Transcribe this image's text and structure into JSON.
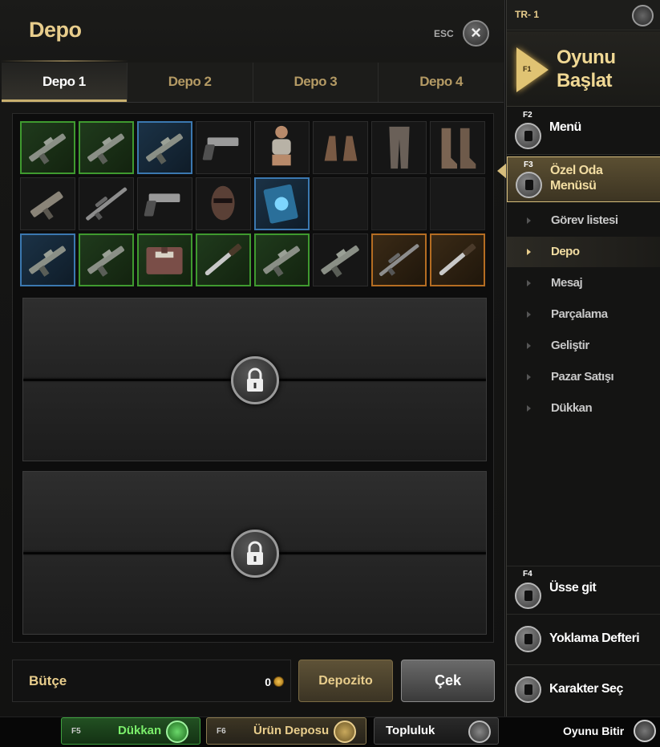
{
  "window": {
    "title": "Depo",
    "esc_label": "ESC"
  },
  "tabs": [
    {
      "label": "Depo 1",
      "active": true
    },
    {
      "label": "Depo 2",
      "active": false
    },
    {
      "label": "Depo 3",
      "active": false
    },
    {
      "label": "Depo 4",
      "active": false
    }
  ],
  "inventory": {
    "slots": [
      {
        "item": "rifle-icon",
        "rarity": "green"
      },
      {
        "item": "rifle-icon",
        "rarity": "green"
      },
      {
        "item": "rifle-icon",
        "rarity": "blue"
      },
      {
        "item": "pistol-icon",
        "rarity": "none"
      },
      {
        "item": "top-clothing-icon",
        "rarity": "none"
      },
      {
        "item": "gloves-icon",
        "rarity": "none"
      },
      {
        "item": "pants-icon",
        "rarity": "none"
      },
      {
        "item": "boots-icon",
        "rarity": "none"
      },
      {
        "item": "smg-icon",
        "rarity": "none"
      },
      {
        "item": "sniper-rifle-icon",
        "rarity": "none"
      },
      {
        "item": "pistol-icon",
        "rarity": "none"
      },
      {
        "item": "mask-icon",
        "rarity": "none"
      },
      {
        "item": "card-icon",
        "rarity": "blue"
      },
      {
        "item": "",
        "rarity": "empty"
      },
      {
        "item": "",
        "rarity": "empty"
      },
      {
        "item": "",
        "rarity": "empty"
      },
      {
        "item": "rifle-icon",
        "rarity": "blue"
      },
      {
        "item": "rifle-icon",
        "rarity": "green"
      },
      {
        "item": "medkit-icon",
        "rarity": "green"
      },
      {
        "item": "knife-icon",
        "rarity": "green"
      },
      {
        "item": "rifle-icon",
        "rarity": "green"
      },
      {
        "item": "rifle-icon",
        "rarity": "none"
      },
      {
        "item": "sniper-rifle-icon",
        "rarity": "orange"
      },
      {
        "item": "knife-icon",
        "rarity": "orange"
      }
    ],
    "locked_sections": [
      {
        "icon": "lock-icon"
      },
      {
        "icon": "lock-icon"
      }
    ]
  },
  "budget": {
    "label": "Bütçe",
    "value": "0",
    "currency_icon": "coin-icon"
  },
  "actions": {
    "deposit": "Depozito",
    "withdraw": "Çek"
  },
  "sidebar": {
    "server": "TR- 1",
    "start": {
      "key": "F1",
      "label": "Oyunu Başlat"
    },
    "menu": {
      "key": "F2",
      "label": "Menü"
    },
    "room_menu": {
      "key": "F3",
      "label": "Özel Oda Menüsü"
    },
    "submenu": [
      {
        "label": "Görev listesi",
        "active": false
      },
      {
        "label": "Depo",
        "active": true
      },
      {
        "label": "Mesaj",
        "active": false
      },
      {
        "label": "Parçalama",
        "active": false
      },
      {
        "label": "Geliştir",
        "active": false
      },
      {
        "label": "Pazar Satışı",
        "active": false
      },
      {
        "label": "Dükkan",
        "active": false
      }
    ],
    "base": {
      "key": "F4",
      "label": "Üsse git"
    },
    "attendance": {
      "label": "Yoklama Defteri"
    },
    "character": {
      "label": "Karakter Seç"
    }
  },
  "bottom_bar": {
    "shop": {
      "key": "F5",
      "label": "Dükkan"
    },
    "item_storage": {
      "key": "F6",
      "label": "Ürün Deposu"
    },
    "community": {
      "label": "Topluluk"
    },
    "quit": {
      "label": "Oyunu Bitir"
    }
  },
  "colors": {
    "accent_gold": "#e8cd8c",
    "rarity_green": "#3f9a2f",
    "rarity_blue": "#3b78b0",
    "rarity_orange": "#b56d22"
  }
}
